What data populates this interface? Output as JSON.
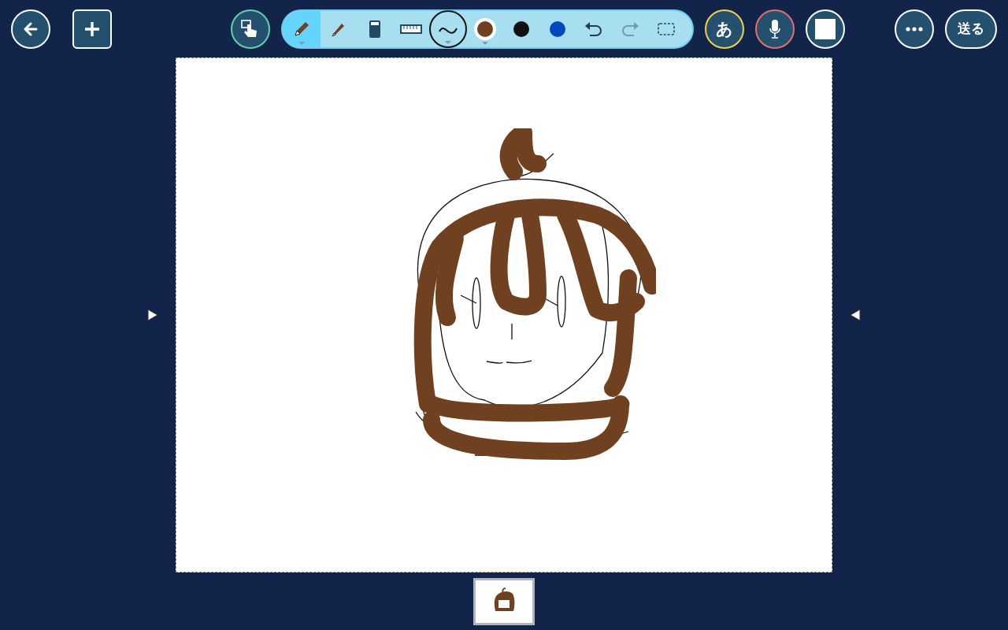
{
  "top_bar": {
    "text_button": "あ",
    "send_button": "送る"
  },
  "tools": [
    {
      "kind": "pen",
      "selected": true
    },
    {
      "kind": "marker",
      "selected": false
    },
    {
      "kind": "eraser",
      "selected": false
    },
    {
      "kind": "ruler",
      "selected": false
    }
  ],
  "colors": [
    {
      "color": "#6f4120",
      "selected": true
    },
    {
      "color": "#111111",
      "selected": false
    },
    {
      "color": "#0047bb",
      "selected": false
    }
  ],
  "actions": [
    {
      "kind": "undo",
      "disabled": false
    },
    {
      "kind": "redo",
      "disabled": true
    }
  ],
  "pages": [
    {
      "selected": true
    }
  ]
}
